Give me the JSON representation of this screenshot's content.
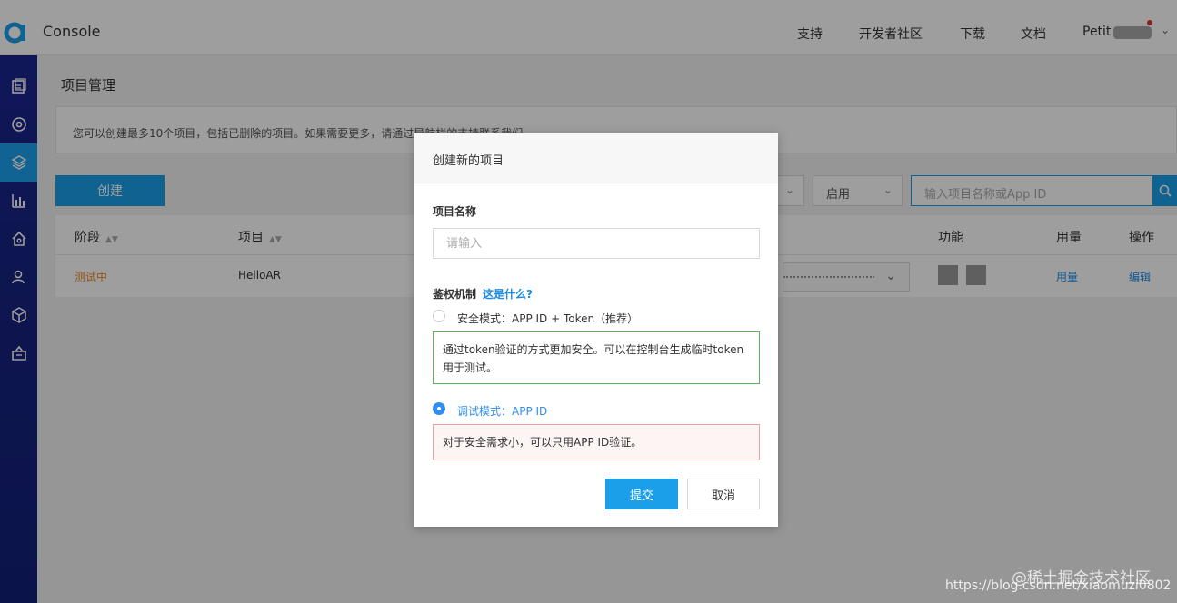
{
  "header": {
    "app_name": "Console",
    "nav": [
      "支持",
      "开发者社区",
      "下载",
      "文档"
    ],
    "user": "Petit"
  },
  "sidebar": {
    "icons": [
      "document-icon",
      "target-icon",
      "layers-icon",
      "bar-chart-icon",
      "home-icon",
      "users-icon",
      "cube-icon",
      "bag-icon"
    ],
    "active_index": 2
  },
  "main": {
    "page_title": "项目管理",
    "notice": "您可以创建最多10个项目，包括已删除的项目。如果需要更多，请通过导航栏的支持联系我们。",
    "create_button": "创建",
    "status_filter": "启用",
    "search_placeholder": "输入项目名称或App ID"
  },
  "table": {
    "headers": {
      "stage": "阶段",
      "project": "项目",
      "function": "功能",
      "usage": "用量",
      "action": "操作"
    },
    "rows": [
      {
        "stage": "测试中",
        "project": "HelloAR",
        "usage": "用量",
        "action": "编辑"
      }
    ]
  },
  "modal": {
    "title": "创建新的项目",
    "name_label": "项目名称",
    "name_placeholder": "请输入",
    "auth_label": "鉴权机制",
    "auth_link": "这是什么?",
    "option_secure": "安全模式：APP ID + Token（推荐）",
    "option_secure_desc": "通过token验证的方式更加安全。可以在控制台生成临时token用于测试。",
    "option_debug": "调试模式：APP ID",
    "option_debug_desc": "对于安全需求小，可以只用APP ID验证。",
    "selected_option": "debug",
    "submit": "提交",
    "cancel": "取消"
  },
  "watermark": {
    "line1": "@稀土掘金技术社区",
    "line2": "https://blog.csdn.net/xiaomuzi0802"
  },
  "colors": {
    "accent": "#1a9fe8",
    "sidebar": "#17237f",
    "status_testing": "#e8871a",
    "secure_border": "#5bb35b",
    "debug_border": "#e5a3a3"
  }
}
